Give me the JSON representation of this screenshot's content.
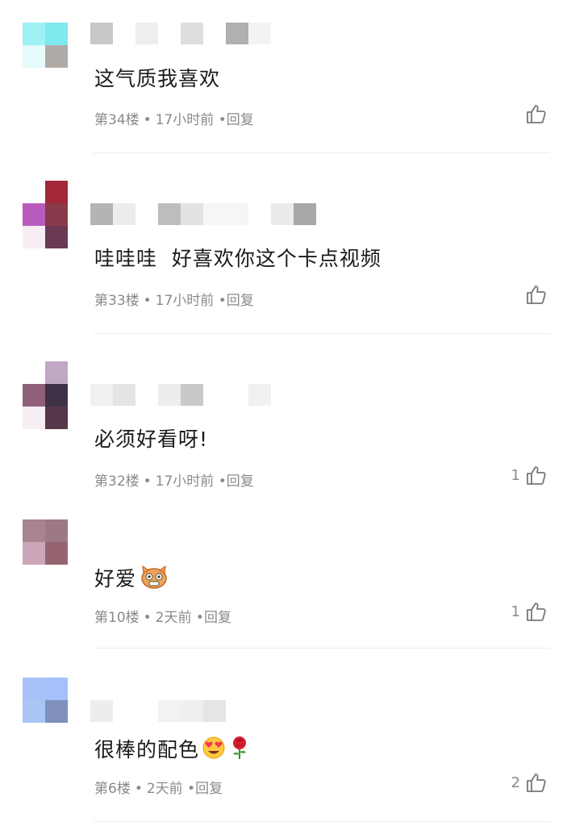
{
  "comments": [
    {
      "text": "这气质我喜欢",
      "floor": "第34楼",
      "time": "17小时前",
      "reply": "回复",
      "likes": "",
      "avatar_colors": [
        "#9ff1f4",
        "#7fe9f0",
        "#e6fbfb",
        "#b0aaa7"
      ],
      "emojis": []
    },
    {
      "text": "哇哇哇  好喜欢你这个卡点视频",
      "floor": "第33楼",
      "time": "17小时前",
      "reply": "回复",
      "likes": "",
      "avatar_colors": [
        "#ffffff",
        "#a32838",
        "#b95bbd",
        "#8a3a4a",
        "#f7eef3",
        "#6a3a55"
      ],
      "emojis": []
    },
    {
      "text": "必须好看呀!",
      "floor": "第32楼",
      "time": "17小时前",
      "reply": "回复",
      "likes": "1",
      "avatar_colors": [
        "#ffffff",
        "#c0a8c4",
        "#8f6078",
        "#3e3346",
        "#f6eef3",
        "#56364a"
      ],
      "emojis": []
    },
    {
      "text": "好爱",
      "floor": "第10楼",
      "time": "2天前",
      "reply": "回复",
      "likes": "1",
      "avatar_colors": [
        "#a9838f",
        "#9d7985",
        "#cda6ba",
        "#966471"
      ],
      "emojis": [
        "cat-emoji"
      ]
    },
    {
      "text": "很棒的配色",
      "floor": "第6楼",
      "time": "2天前",
      "reply": "回复",
      "likes": "2",
      "avatar_colors": [
        "#a7c2f7",
        "#a4c2f9",
        "#a9c5f6",
        "#7f90ba"
      ],
      "emojis": [
        "heart-eyes-emoji",
        "rose-emoji"
      ]
    }
  ],
  "meta_separator": "•",
  "reply_prefix": "•"
}
